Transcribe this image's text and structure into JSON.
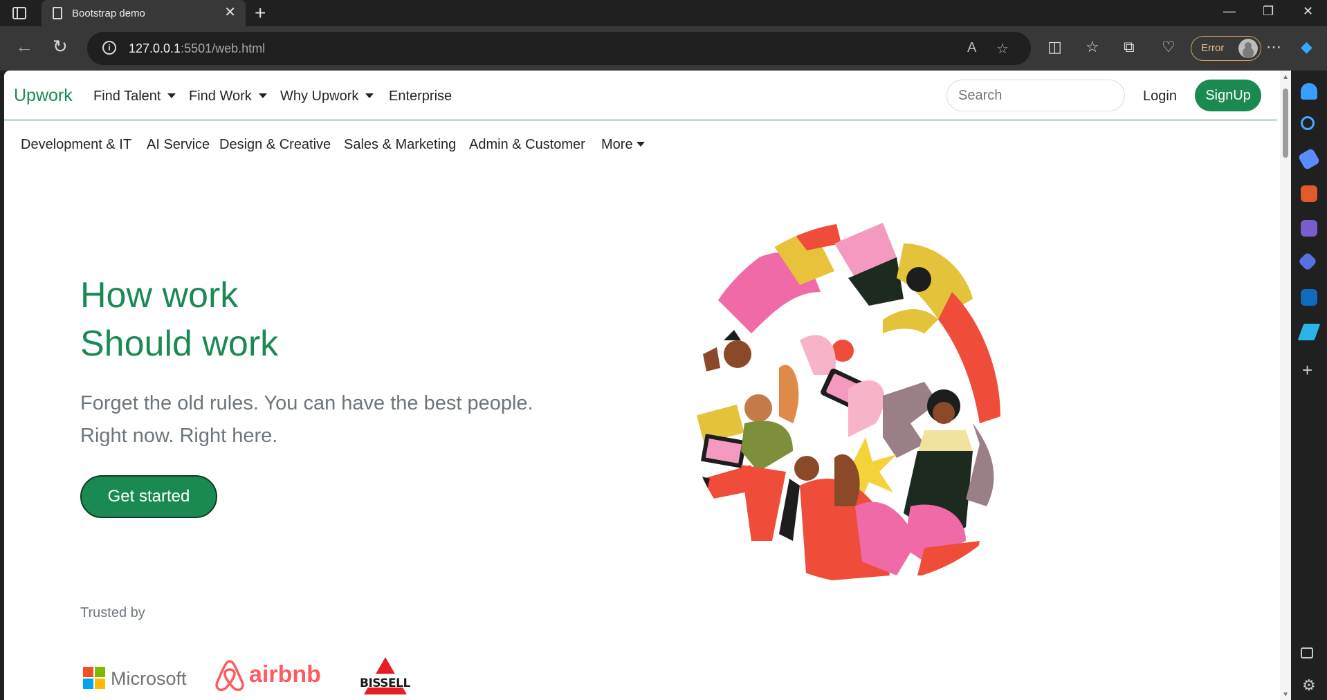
{
  "browser": {
    "tab_title": "Bootstrap demo",
    "url_host": "127.0.0.1",
    "url_rest": ":5501/web.html",
    "profile_status": "Error"
  },
  "navbar": {
    "brand": "Upwork",
    "items": [
      {
        "label": "Find Talent",
        "dropdown": true
      },
      {
        "label": "Find Work",
        "dropdown": true
      },
      {
        "label": "Why Upwork",
        "dropdown": true
      },
      {
        "label": "Enterprise",
        "dropdown": false
      }
    ],
    "search_placeholder": "Search",
    "login": "Login",
    "signup": "SignUp"
  },
  "categories": [
    "Development & IT",
    "AI Service",
    "Design & Creative",
    "Sales & Marketing",
    "Admin & Customer",
    "More"
  ],
  "hero": {
    "title_line1": "How work",
    "title_line2": "Should work",
    "subtitle_line1": "Forget the old rules. You can have the best people.",
    "subtitle_line2": "Right now. Right here.",
    "cta": "Get started",
    "trusted_by": "Trusted by"
  },
  "logos": {
    "microsoft": "Microsoft",
    "airbnb": "airbnb",
    "bissell": "BISSELL"
  },
  "colors": {
    "brand_green": "#1b8a52",
    "muted_text": "#6c757d",
    "airbnb_red": "#ff5a5f",
    "bissell_red": "#e31e24"
  }
}
